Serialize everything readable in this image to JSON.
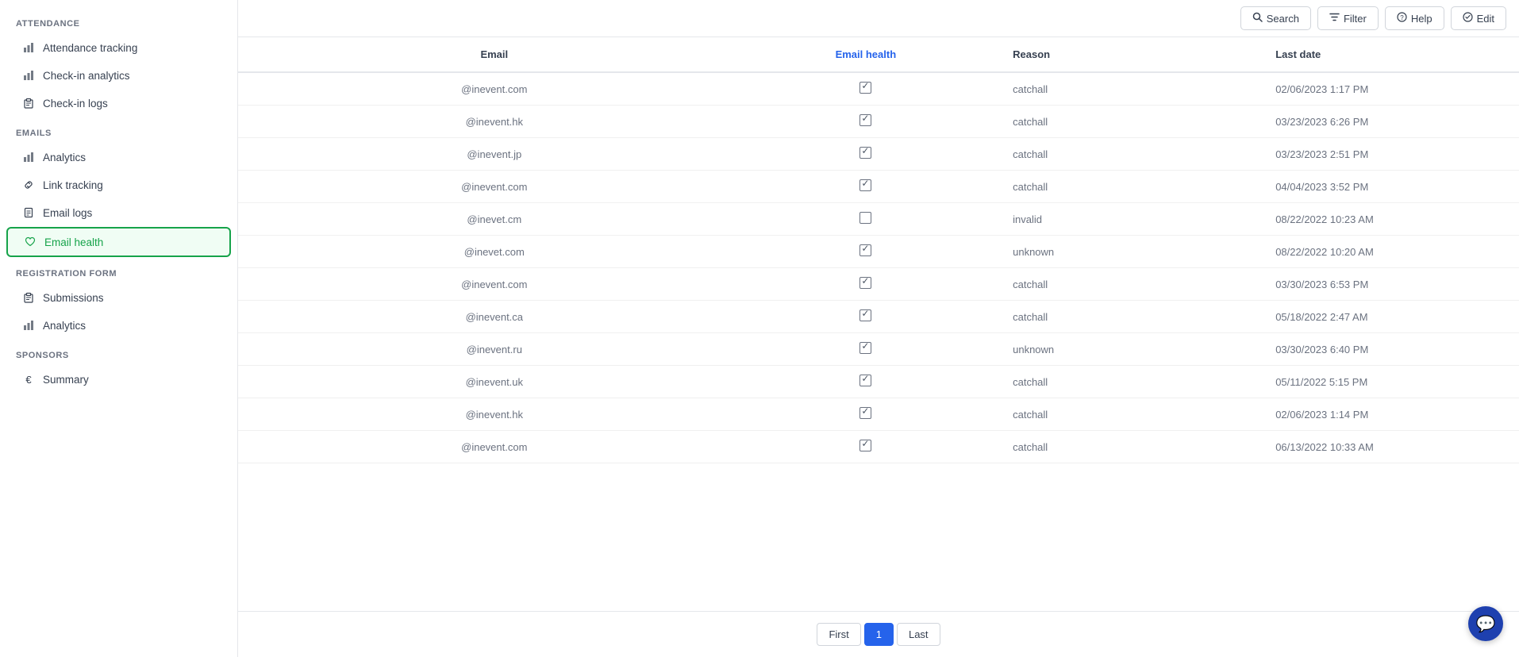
{
  "sidebar": {
    "sections": [
      {
        "title": "ATTENDANCE",
        "items": [
          {
            "id": "attendance-tracking",
            "label": "Attendance tracking",
            "icon": "bar-chart",
            "active": false
          },
          {
            "id": "check-in-analytics",
            "label": "Check-in analytics",
            "icon": "bar-chart",
            "active": false
          },
          {
            "id": "check-in-logs",
            "label": "Check-in logs",
            "icon": "clipboard",
            "active": false
          }
        ]
      },
      {
        "title": "EMAILS",
        "items": [
          {
            "id": "analytics",
            "label": "Analytics",
            "icon": "bar-chart",
            "active": false
          },
          {
            "id": "link-tracking",
            "label": "Link tracking",
            "icon": "link",
            "active": false
          },
          {
            "id": "email-logs",
            "label": "Email logs",
            "icon": "file",
            "active": false
          },
          {
            "id": "email-health",
            "label": "Email health",
            "icon": "heart",
            "active": true
          }
        ]
      },
      {
        "title": "REGISTRATION FORM",
        "items": [
          {
            "id": "submissions",
            "label": "Submissions",
            "icon": "clipboard",
            "active": false
          },
          {
            "id": "reg-analytics",
            "label": "Analytics",
            "icon": "bar-chart",
            "active": false
          }
        ]
      },
      {
        "title": "SPONSORS",
        "items": [
          {
            "id": "summary",
            "label": "Summary",
            "icon": "euro",
            "active": false
          }
        ]
      }
    ]
  },
  "topbar": {
    "buttons": [
      {
        "id": "search",
        "label": "Search",
        "icon": "🔍"
      },
      {
        "id": "filter",
        "label": "Filter",
        "icon": "▼"
      },
      {
        "id": "help",
        "label": "Help",
        "icon": "?"
      },
      {
        "id": "edit",
        "label": "Edit",
        "icon": "⚙"
      }
    ]
  },
  "table": {
    "columns": [
      {
        "id": "email",
        "label": "Email"
      },
      {
        "id": "health",
        "label": "Email health"
      },
      {
        "id": "reason",
        "label": "Reason"
      },
      {
        "id": "date",
        "label": "Last date"
      }
    ],
    "rows": [
      {
        "email": "@inevent.com",
        "health": true,
        "reason": "catchall",
        "date": "02/06/2023 1:17 PM"
      },
      {
        "email": "@inevent.hk",
        "health": true,
        "reason": "catchall",
        "date": "03/23/2023 6:26 PM"
      },
      {
        "email": "@inevent.jp",
        "health": true,
        "reason": "catchall",
        "date": "03/23/2023 2:51 PM"
      },
      {
        "email": "@inevent.com",
        "health": true,
        "reason": "catchall",
        "date": "04/04/2023 3:52 PM"
      },
      {
        "email": "@inevet.cm",
        "health": false,
        "reason": "invalid",
        "date": "08/22/2022 10:23 AM"
      },
      {
        "email": "@inevet.com",
        "health": true,
        "reason": "unknown",
        "date": "08/22/2022 10:20 AM"
      },
      {
        "email": "@inevent.com",
        "health": true,
        "reason": "catchall",
        "date": "03/30/2023 6:53 PM"
      },
      {
        "email": "@inevent.ca",
        "health": true,
        "reason": "catchall",
        "date": "05/18/2022 2:47 AM"
      },
      {
        "email": "@inevent.ru",
        "health": true,
        "reason": "unknown",
        "date": "03/30/2023 6:40 PM"
      },
      {
        "email": "@inevent.uk",
        "health": true,
        "reason": "catchall",
        "date": "05/11/2022 5:15 PM"
      },
      {
        "email": "@inevent.hk",
        "health": true,
        "reason": "catchall",
        "date": "02/06/2023 1:14 PM"
      },
      {
        "email": "@inevent.com",
        "health": true,
        "reason": "catchall",
        "date": "06/13/2022 10:33 AM"
      }
    ]
  },
  "pagination": {
    "first_label": "First",
    "last_label": "Last",
    "current_page": 1
  }
}
